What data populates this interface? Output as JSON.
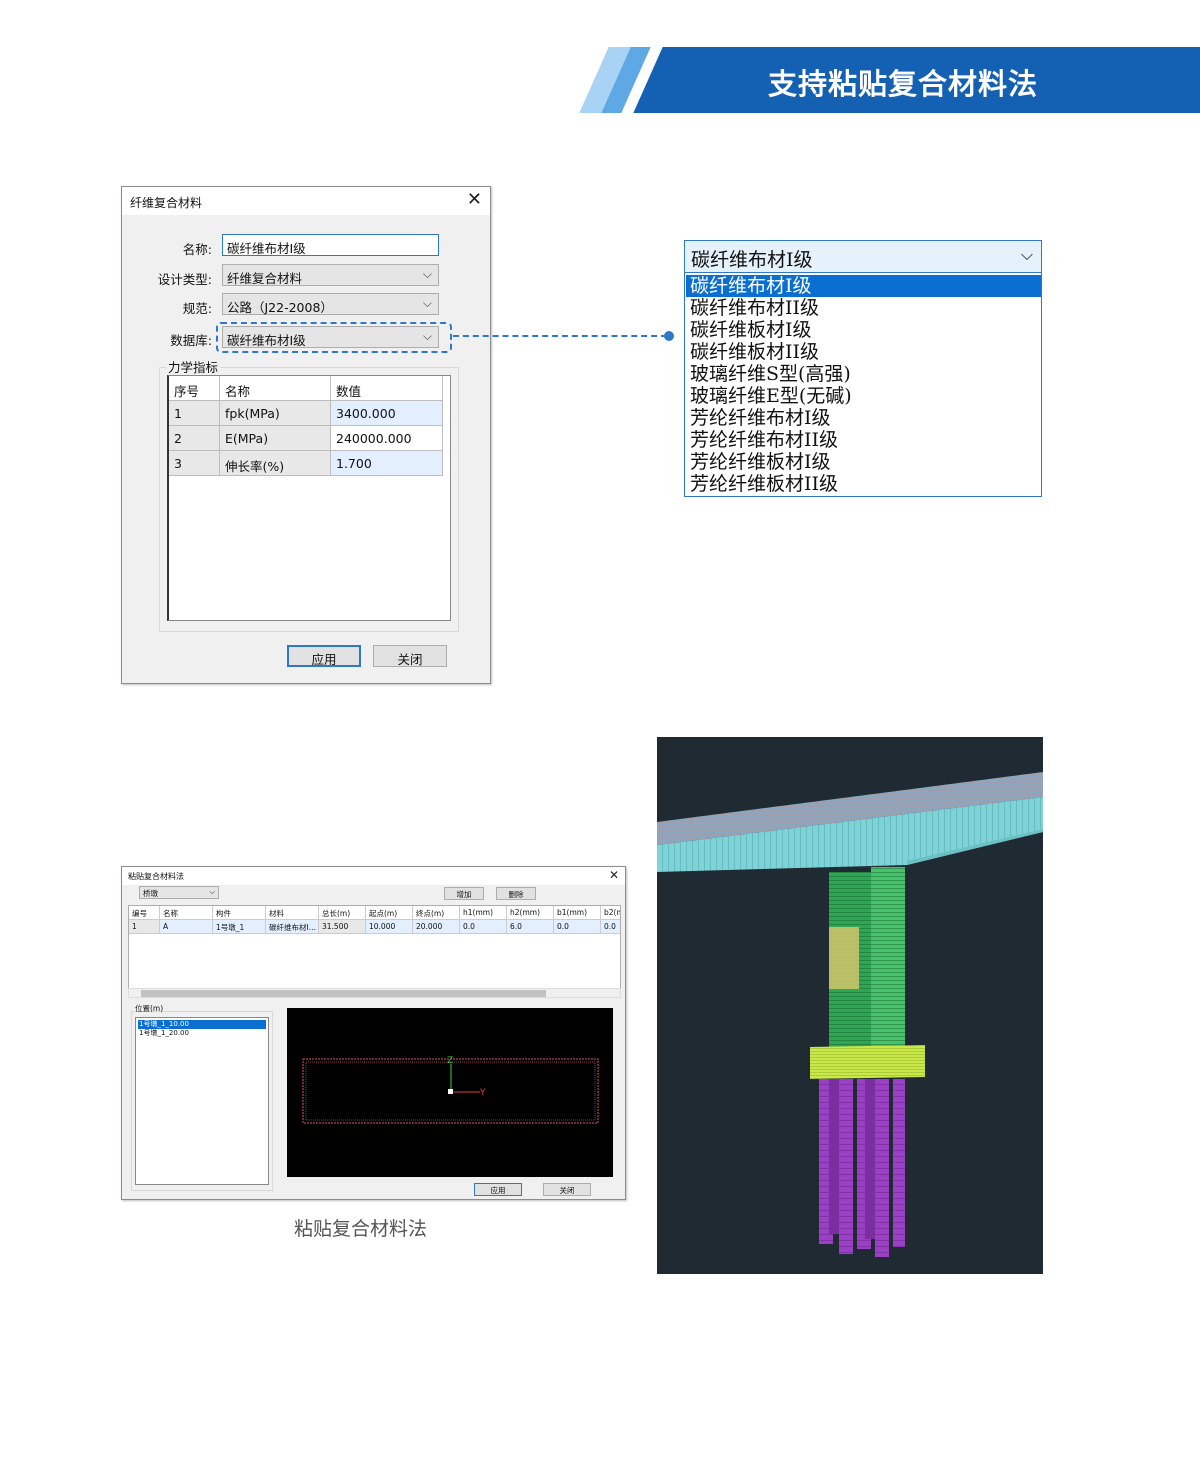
{
  "banner": {
    "title": "支持粘贴复合材料法"
  },
  "dialog1": {
    "title": "纤维复合材料",
    "fields": {
      "name_label": "名称:",
      "name_value": "碳纤维布材I级",
      "type_label": "设计类型:",
      "type_value": "纤维复合材料",
      "spec_label": "规范:",
      "spec_value": "公路（J22-2008）",
      "db_label": "数据库:",
      "db_value": "碳纤维布材I级"
    },
    "group_label": "力学指标",
    "table": {
      "headers": [
        "序号",
        "名称",
        "数值"
      ],
      "rows": [
        [
          "1",
          "fpk(MPa)",
          "3400.000"
        ],
        [
          "2",
          "E(MPa)",
          "240000.000"
        ],
        [
          "3",
          "伸长率(%)",
          "1.700"
        ]
      ]
    },
    "apply_label": "应用",
    "close_label": "关闭"
  },
  "dropdown": {
    "selected": "碳纤维布材I级",
    "options": [
      "碳纤维布材I级",
      "碳纤维布材II级",
      "碳纤维板材I级",
      "碳纤维板材II级",
      "玻璃纤维S型(高强)",
      "玻璃纤维E型(无碱)",
      "芳纶纤维布材I级",
      "芳纶纤维布材II级",
      "芳纶纤维板材I级",
      "芳纶纤维板材II级"
    ]
  },
  "dialog2": {
    "title": "粘贴复合材料法",
    "combo_value": "桥墩",
    "add_label": "增加",
    "delete_label": "删除",
    "table": {
      "headers": [
        "编号",
        "名称",
        "构件",
        "材料",
        "总长(m)",
        "起点(m)",
        "终点(m)",
        "h1(mm)",
        "h2(mm)",
        "b1(mm)",
        "b2(m"
      ],
      "rows": [
        [
          "1",
          "A",
          "1号墩_1",
          "碳纤维布材I...",
          "31.500",
          "10.000",
          "20.000",
          "0.0",
          "6.0",
          "0.0",
          "0.0"
        ]
      ]
    },
    "position_label": "位置(m)",
    "positions": [
      "1号墩_1_10.00",
      "1号墩_1_20.00"
    ],
    "axis_z": "Z",
    "axis_y": "Y",
    "apply_label": "应用",
    "close_label": "关闭"
  },
  "caption": "粘贴复合材料法"
}
